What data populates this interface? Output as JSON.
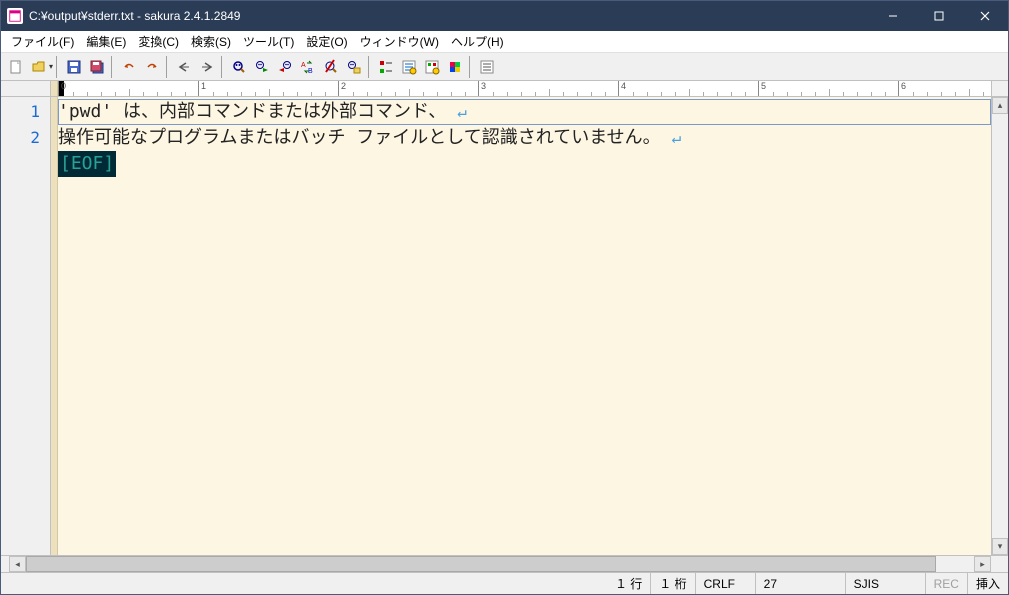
{
  "window": {
    "title": "C:¥output¥stderr.txt - sakura 2.4.1.2849"
  },
  "menu": {
    "file": "ファイル(F)",
    "edit": "編集(E)",
    "convert": "変換(C)",
    "search": "検索(S)",
    "tool": "ツール(T)",
    "setting": "設定(O)",
    "window": "ウィンドウ(W)",
    "help": "ヘルプ(H)"
  },
  "ruler": {
    "marks": [
      "0",
      "1",
      "2",
      "3",
      "4",
      "5",
      "6"
    ]
  },
  "content": {
    "lines": [
      {
        "num": "1",
        "text": "'pwd' は、内部コマンドまたは外部コマンド、"
      },
      {
        "num": "2",
        "text": "操作可能なプログラムまたはバッチ ファイルとして認識されていません。"
      }
    ],
    "eof": "[EOF]"
  },
  "status": {
    "line": "１ 行",
    "col": "１ 桁",
    "eol": "CRLF",
    "code": "27",
    "enc": "SJIS",
    "rec": "REC",
    "mode": "挿入"
  }
}
